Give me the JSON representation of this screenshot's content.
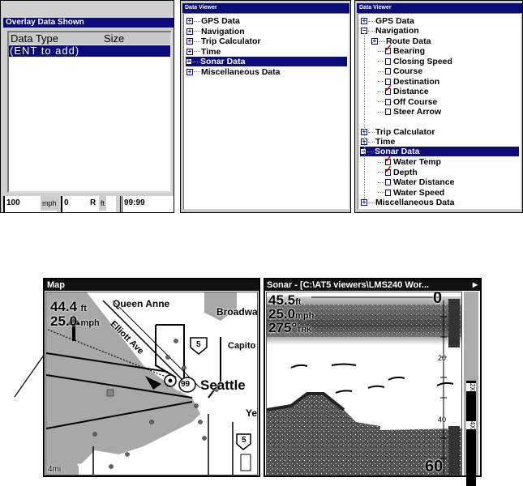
{
  "overlay_panel": {
    "title": "Overlay Data Shown",
    "col_type": "Data Type",
    "col_size": "Size",
    "row": "(ENT to add)",
    "status": {
      "speed": "100",
      "speed_unit": "mph",
      "depth": "0",
      "depth_flag": "R",
      "depth_unit": "ft",
      "time": "99:99"
    }
  },
  "viewer_collapsed": {
    "title": "Data Viewer",
    "items": [
      "GPS Data",
      "Navigation",
      "Trip Calculator",
      "Time",
      "Sonar Data",
      "Miscellaneous Data"
    ],
    "selected": "Sonar Data"
  },
  "viewer_expanded": {
    "title": "Data Viewer",
    "gps": "GPS Data",
    "navigation": "Navigation",
    "route_data": "Route Data",
    "nav_children": [
      {
        "label": "Bearing",
        "checked": true
      },
      {
        "label": "Closing Speed",
        "checked": false
      },
      {
        "label": "Course",
        "checked": false
      },
      {
        "label": "Destination",
        "checked": false
      },
      {
        "label": "Distance",
        "checked": true
      },
      {
        "label": "Off Course",
        "checked": false
      },
      {
        "label": "Steer Arrow",
        "checked": false
      }
    ],
    "trip": "Trip Calculator",
    "time": "Time",
    "sonar": "Sonar Data",
    "sonar_children": [
      {
        "label": "Water Temp",
        "checked": true
      },
      {
        "label": "Depth",
        "checked": true
      },
      {
        "label": "Water Distance",
        "checked": false
      },
      {
        "label": "Water Speed",
        "checked": false
      }
    ],
    "misc": "Miscellaneous Data"
  },
  "map": {
    "title": "Map",
    "depth": "44.4",
    "depth_unit": "ft",
    "speed": "25.0",
    "speed_unit": "mph",
    "scale": "4mi",
    "labels": {
      "queen_anne": "Queen Anne",
      "elliott": "Elliott Ave",
      "broadway": "Broadwa",
      "capitol": "Capito",
      "seattle": "Seattle",
      "ye": "Ye",
      "hwy99": "99",
      "hwy5a": "5",
      "hwy5b": "5"
    }
  },
  "sonar": {
    "title": "Sonar - [C:\\AT5 viewers\\LMS240 Wor...",
    "depth": "45.5",
    "depth_unit": "ft",
    "speed": "25.0",
    "speed_unit": "mph",
    "track": "275°",
    "track_unit": "TRK",
    "scale_top": "0",
    "scale_20": "20",
    "scale_40": "40",
    "scale_bottom": "60",
    "zoom_2x": "2X",
    "zoom_4x": "4X"
  },
  "colors": {
    "title_bar": "#0a0a78",
    "water": "#a8a8a8",
    "check": "#cc0000"
  }
}
